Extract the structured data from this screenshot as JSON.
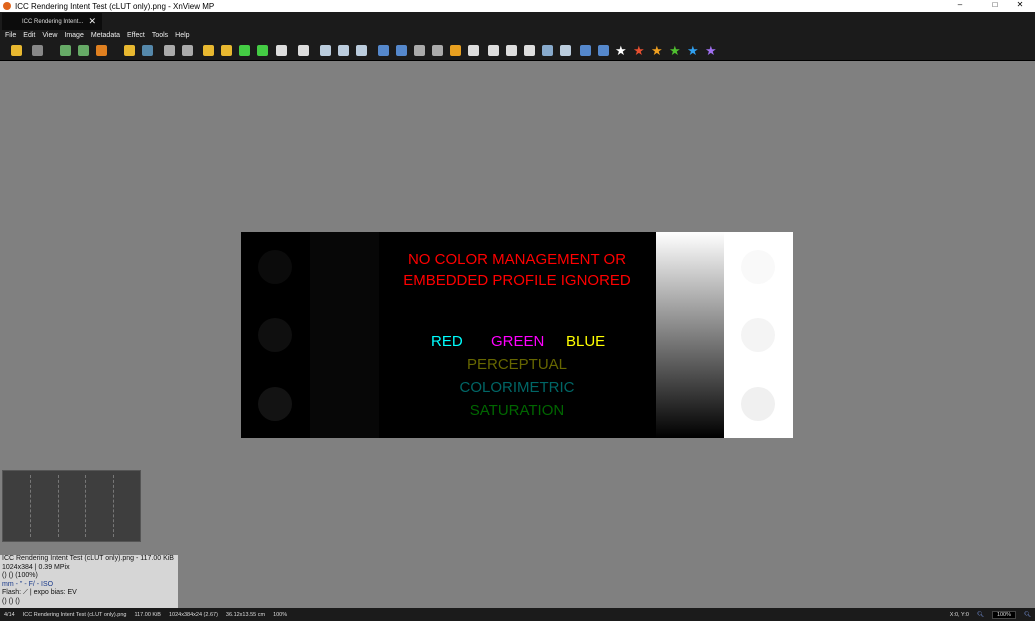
{
  "window": {
    "title": "ICC Rendering Intent Test (cLUT only).png - XnView MP",
    "minimize": "–",
    "maximize": "□",
    "close": "✕"
  },
  "tab": {
    "label": "ICC Rendering Intent...",
    "close": "✕"
  },
  "menu": [
    "File",
    "Edit",
    "View",
    "Image",
    "Metadata",
    "Effect",
    "Tools",
    "Help"
  ],
  "toolbar_colors": [
    "#e8b830",
    "#888",
    "#6a6",
    "#6a6",
    "#e08020",
    "#e8b830",
    "#58a",
    "#aaa",
    "#aaa",
    "#e8b830",
    "#e8b830",
    "#4c4",
    "#4c4",
    "#ddd",
    "#ddd",
    "#bcd",
    "#bcd",
    "#bcd",
    "#58c",
    "#58c",
    "#aaa",
    "#aaa",
    "#e8a020",
    "#ddd",
    "#ddd",
    "#ddd",
    "#ddd",
    "#8ac",
    "#bcd",
    "#58c",
    "#58c"
  ],
  "stars": [
    "#ffffff",
    "#e85030",
    "#f0a020",
    "#50c030",
    "#30a0f0",
    "#a070f0"
  ],
  "image": {
    "line1": "NO COLOR MANAGEMENT OR",
    "line2": "EMBEDDED PROFILE IGNORED",
    "red": "RED",
    "green": "GREEN",
    "blue": "BLUE",
    "perceptual": "PERCEPTUAL",
    "colorimetric": "COLORIMETRIC",
    "saturation": "SATURATION"
  },
  "info": [
    "ICC Rendering Intent Test (cLUT only).png - 117.00 KiB",
    "1024x384 | 0.39 MPix",
    "() () (100%)",
    "mm - \" - F/ - ISO",
    "Flash:  ⟋ | expo bias:  EV",
    "() () ()"
  ],
  "status": {
    "index": "4/14",
    "filename": "ICC Rendering Intent Test (cLUT only).png",
    "size": "117.00 KiB",
    "dims": "1024x384x24 (2.67)",
    "physical": "36.12x13.55 cm",
    "zoom_pct": "100%",
    "coords": "X:0, Y:0",
    "zoom_box": "100%"
  }
}
